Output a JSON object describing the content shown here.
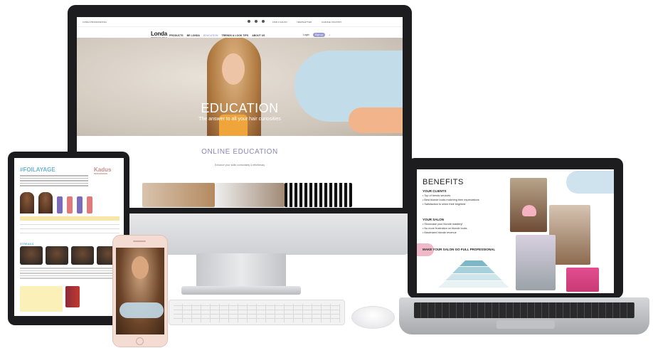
{
  "imac_site": {
    "topbar": {
      "country": "LONDA PROFESSIONAL",
      "find_salon": "FIND A SALON",
      "newsletter": "NEWSLETTER",
      "change_country": "CHANGE COUNTRY"
    },
    "logo": "Londa",
    "logo_sub": "PROFESSIONAL",
    "nav": [
      "PRODUCTS",
      "BE LONDA",
      "EDUCATION",
      "TRENDS & LOOK TIPS",
      "ABOUT US"
    ],
    "active_nav": "EDUCATION",
    "login": "Login",
    "signup": "Sign up",
    "hero_title": "EDUCATION",
    "hero_subtitle": "The answer to all your hair curiosities",
    "section_title": "ONLINE EDUCATION",
    "section_subtitle": "Enhance your skills comfortably & effortlessly",
    "colors": {
      "accent": "#9a9ad2",
      "blob_blue": "#c2dcea",
      "blob_orange": "#f2b48a"
    }
  },
  "tablet_doc": {
    "title": "#FOILAYAGE",
    "brand": "Kadus",
    "brand_sub": "PROFESSIONAL",
    "section_label": "STREAKS"
  },
  "laptop_doc": {
    "title": "BENEFITS",
    "clients_heading": "YOUR CLIENTS",
    "clients_items": [
      "Top of trends services",
      "Best blonde looks matching their expectations",
      "Satisfaction to shine their brightest"
    ],
    "salon_heading": "YOUR SALON",
    "salon_items": [
      "Showcase your blonde mastery!",
      "No more frustration on blonde looks",
      "Maximized blonde revenue"
    ],
    "go_heading": "MAKE YOUR SALON GO FULL PROFESSIONAL"
  },
  "icons": [
    "facebook-icon",
    "instagram-icon",
    "youtube-icon",
    "search-icon",
    "pin-icon",
    "mail-icon",
    "globe-icon"
  ]
}
